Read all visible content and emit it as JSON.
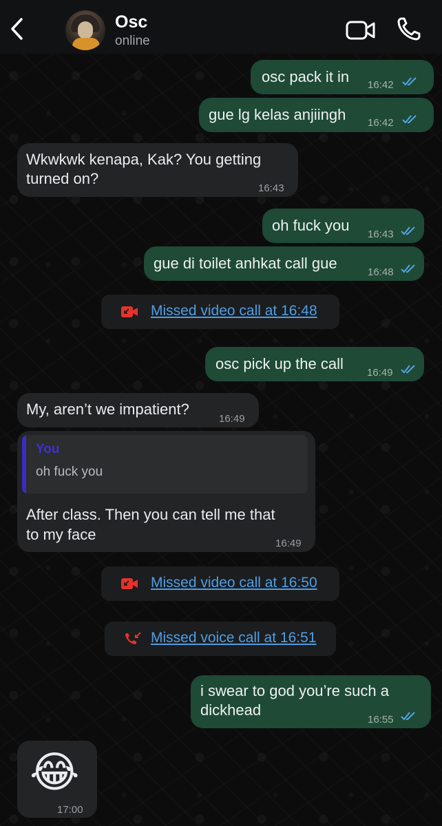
{
  "header": {
    "contact_name": "Osc",
    "status": "online"
  },
  "messages": [
    {
      "text": "osc pack it in",
      "time": "16:42"
    },
    {
      "text": "gue lg kelas anjiingh",
      "time": "16:42"
    },
    {
      "text_line1": "Wkwkwk kenapa, Kak? You getting",
      "text_line2": "turned on?",
      "time": "16:43"
    },
    {
      "text": "oh fuck you",
      "time": "16:43"
    },
    {
      "text": "gue di toilet anhkat call gue",
      "time": "16:48"
    },
    {
      "text": "osc pick up the call",
      "time": "16:49"
    },
    {
      "text": "My, aren’t we impatient?",
      "time": "16:49"
    },
    {
      "quote_author": "You",
      "quote_text": "oh fuck you",
      "text_line1": "After class. Then you can tell me that",
      "text_line2": "to my face",
      "time": "16:49"
    },
    {
      "text_line1": "i swear to god you’re such a",
      "text_line2": "dickhead",
      "time": "16:55"
    },
    {
      "emoji": "😂",
      "time": "17:00"
    }
  ],
  "system": [
    {
      "label": "Missed video call at 16:48",
      "icon": "missed-video-call-icon"
    },
    {
      "label": "Missed video call at 16:50",
      "icon": "missed-video-call-icon"
    },
    {
      "label": "Missed voice call at 16:51",
      "icon": "missed-voice-call-icon"
    }
  ],
  "colors": {
    "outgoing_bubble": "#1e4a36",
    "incoming_bubble": "#222425",
    "link_blue": "#4e9fe8",
    "missed_red": "#e5332a",
    "read_ticks": "#53a6e9"
  }
}
